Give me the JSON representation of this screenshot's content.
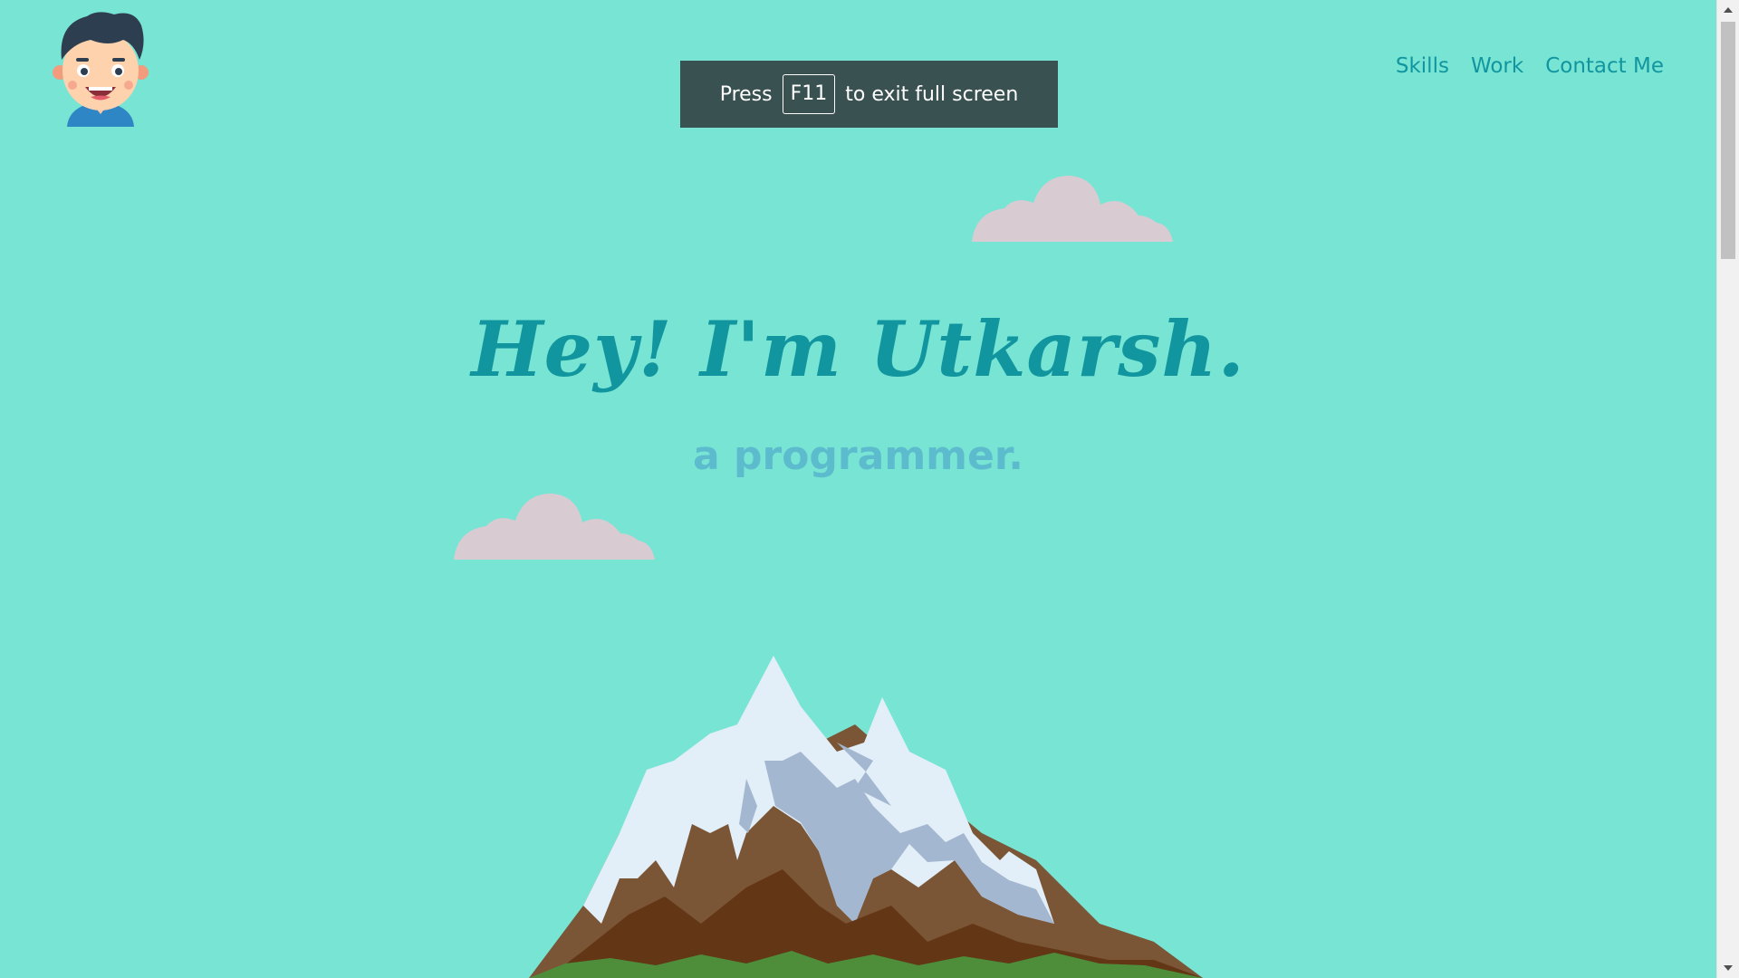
{
  "header": {
    "logo_icon": "boy-avatar-icon",
    "nav": [
      {
        "label": "Skills"
      },
      {
        "label": "Work"
      },
      {
        "label": "Contact Me"
      }
    ]
  },
  "toast": {
    "prefix": "Press",
    "key": "F11",
    "suffix": "to exit full screen"
  },
  "hero": {
    "title": "Hey! I'm Utkarsh.",
    "subtitle": "a programmer."
  },
  "colors": {
    "background": "#78e4d4",
    "accent": "#11969f",
    "subtitle": "#5cbccd",
    "toast_bg": "#3a5152",
    "cloud": "#d9cbd2"
  },
  "decor": {
    "clouds": [
      "cloud-icon",
      "cloud-icon"
    ],
    "mountain": "mountain-illustration"
  },
  "scrollbar": {
    "position": 0
  }
}
